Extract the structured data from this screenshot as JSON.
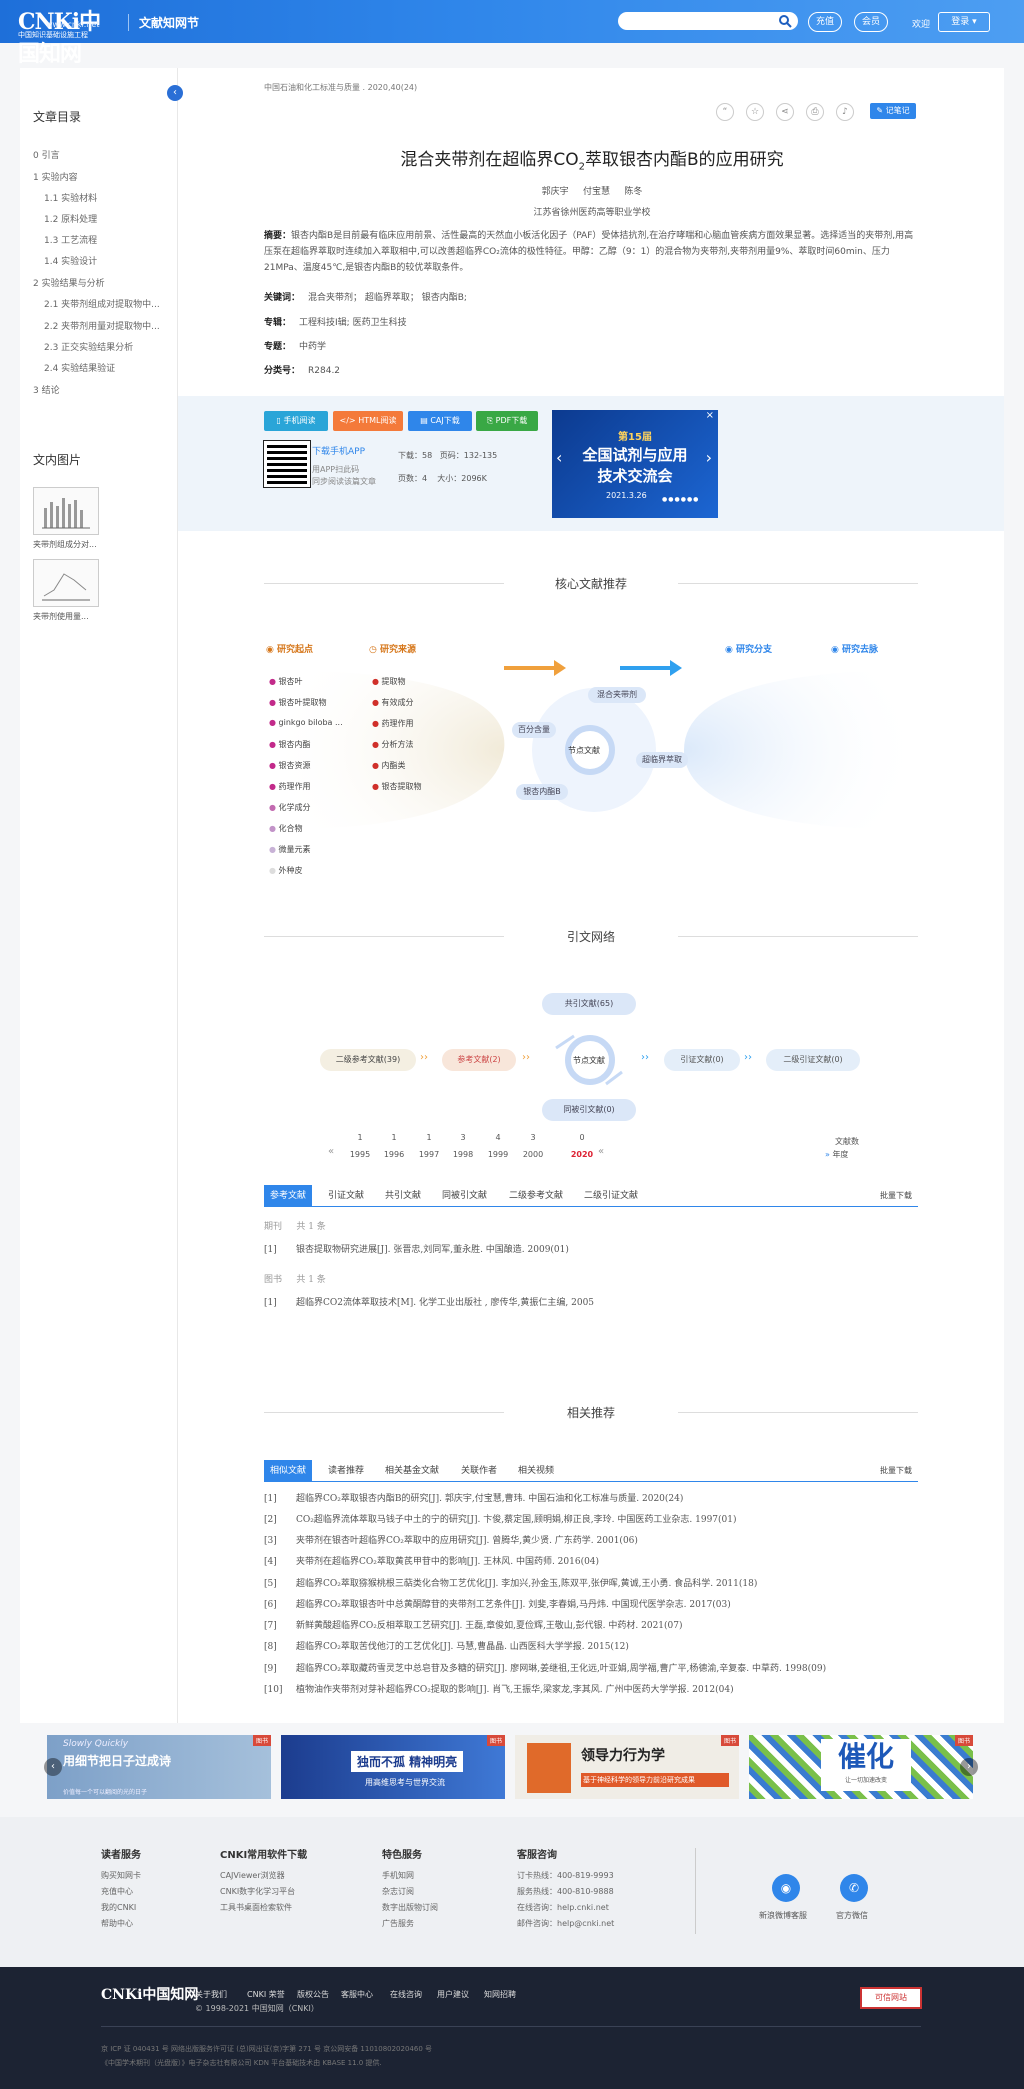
{
  "header": {
    "logo_main": "CNKi中国知网",
    "logo_url": "www.cnki.net",
    "logo_sub": "中国知识基础设施工程",
    "site_name": "文献知网节",
    "btn_recharge": "充值",
    "btn_member": "会员",
    "welcome": "欢迎",
    "login": "登录"
  },
  "sidebar": {
    "toc_title": "文章目录",
    "toc": [
      "0 引言",
      "1 实验内容",
      "1.1 实验材料",
      "1.2 原料处理",
      "1.3 工艺流程",
      "1.4 实验设计",
      "2 实验结果与分析",
      "2.1 夹带剂组成对提取物中...",
      "2.2 夹带剂用量对提取物中...",
      "2.3 正交实验结果分析",
      "2.4 实验结果验证",
      "3 结论"
    ],
    "fig_title": "文内图片",
    "figs": [
      "夹带剂组成分对...",
      "夹带剂使用量..."
    ]
  },
  "article": {
    "journal": "中国石油和化工标准与质量 . 2020,40(24)",
    "note_btn": "记笔记",
    "title_pre": "混合夹带剂在超临界CO",
    "title_sub": "2",
    "title_post": "萃取银杏内酯B的应用研究",
    "authors": [
      "郭庆宇",
      "付宝慧",
      "陈冬"
    ],
    "affiliation": "江苏省徐州医药高等职业学校",
    "abstract_label": "摘要：",
    "abstract": "银杏内酯B是目前最有临床应用前景、活性最高的天然血小板活化因子（PAF）受体拮抗剂,在治疗哮喘和心脑血管疾病方面效果显著。选择适当的夹带剂,用高压泵在超临界萃取时连续加入萃取相中,可以改善超临界CO₂流体的极性特征。甲醇：乙醇（9：1）的混合物为夹带剂,夹带剂用量9%、萃取时间60min、压力21MPa、温度45℃,是银杏内酯B的较优萃取条件。",
    "keywords_label": "关键词：",
    "keywords": "混合夹带剂；  超临界萃取；  银杏内酯B;",
    "series_label": "专辑：",
    "series": "工程科技Ⅰ辑; 医药卫生科技",
    "topic_label": "专题：",
    "topic": "中药学",
    "class_label": "分类号：",
    "class_no": "R284.2"
  },
  "downloads": {
    "btns": [
      "手机阅读",
      "HTML阅读",
      "CAJ下载",
      "PDF下载"
    ],
    "app_link": "下载手机APP",
    "app_hint1": "用APP扫此码",
    "app_hint2": "同步阅读该篇文章",
    "stats1": "下载：58   页码：132-135",
    "stats2": "页数：4    大小：2096K",
    "banner_small": "第15届",
    "banner_line1": "全国试剂与应用",
    "banner_line2": "技术交流会",
    "banner_date": "2021.3.26"
  },
  "core": {
    "heading": "核心文献推荐",
    "start": "研究起点",
    "source": "研究来源",
    "branch": "研究分支",
    "trend": "研究去脉",
    "start_items": [
      "银杏叶",
      "银杏叶提取物",
      "ginkgo biloba ...",
      "银杏内酯",
      "银杏资源",
      "药理作用",
      "化学成分",
      "化合物",
      "微量元素",
      "外种皮"
    ],
    "source_items": [
      "提取物",
      "有效成分",
      "药理作用",
      "分析方法",
      "内酯类",
      "银杏提取物"
    ],
    "node": "节点文献",
    "kw": [
      "混合夹带剂",
      "百分含量",
      "超临界萃取",
      "银杏内酯B"
    ]
  },
  "network": {
    "heading": "引文网络",
    "co_cite": "共引文献(65)",
    "co_cited": "同被引文献(0)",
    "second_ref": "二级参考文献(39)",
    "ref": "参考文献(2)",
    "node": "节点文献",
    "cite": "引证文献(0)",
    "second_cite": "二级引证文献(0)",
    "years": [
      "1995",
      "1996",
      "1997",
      "1998",
      "1999",
      "2000",
      "2020"
    ],
    "counts": [
      "1",
      "1",
      "1",
      "3",
      "4",
      "3",
      "0"
    ],
    "right1": "文献数",
    "right2": "年度"
  },
  "refs": {
    "tabs": [
      "参考文献",
      "引证文献",
      "共引文献",
      "同被引文献",
      "二级参考文献",
      "二级引证文献"
    ],
    "batch": "批量下载",
    "grp1": "期刊",
    "grp1_n": "共 1 条",
    "r1": "银杏提取物研究进展[J]. 张晋忠,刘同军,董永胜. 中国酿造. 2009(01)",
    "grp2": "图书",
    "grp2_n": "共 1 条",
    "r2": "超临界CO2流体萃取技术[M]. 化学工业出版社 , 廖传华,黄振仁主编, 2005"
  },
  "related": {
    "heading": "相关推荐",
    "tabs": [
      "相似文献",
      "读者推荐",
      "相关基金文献",
      "关联作者",
      "相关视频"
    ],
    "batch": "批量下载",
    "items": [
      "超临界CO₂萃取银杏内酯B的研究[J]. 郭庆宇,付宝慧,曹玮. 中国石油和化工标准与质量. 2020(24)",
      "CO₂超临界流体萃取马钱子中土的宁的研究[J]. 卞俊,蔡定国,顾明娟,柳正良,李玲. 中国医药工业杂志. 1997(01)",
      "夹带剂在银杏叶超临界CO₂萃取中的应用研究[J]. 曾腾华,黄少贤. 广东药学. 2001(06)",
      "夹带剂在超临界CO₂萃取黄芪甲苷中的影响[J]. 王林风. 中国药师. 2016(04)",
      "超临界CO₂萃取猕猴桃根三萜类化合物工艺优化[J]. 李加兴,孙金玉,陈双平,张伊晖,黄诚,王小勇. 食品科学. 2011(18)",
      "超临界CO₂萃取银杏叶中总黄酮醇苷的夹带剂工艺条件[J]. 刘斐,李春娟,马丹炜. 中国现代医学杂志. 2017(03)",
      "新鲜黄酸超临界CO₂反相萃取工艺研究[J]. 王磊,章俊如,夏俭辉,王敬山,彭代银. 中药材. 2021(07)",
      "超临界CO₂萃取苦伐他汀的工艺优化[J]. 马慧,曹晶晶. 山西医科大学学报. 2015(12)",
      "超临界CO₂萃取藏药雪灵芝中总皂苷及多糖的研究[J]. 廖网琳,姜继祖,王化远,叶亚娟,周学福,曹广平,杨德渝,辛复泰. 中草药. 1998(09)",
      "植物油作夹带剂对芽补超临界CO₂提取的影响[J]. 肖飞,王振华,梁家龙,李其风. 广州中医药大学学报. 2012(04)"
    ]
  },
  "ads": {
    "a1_top": "Slowly Quickly",
    "a1_main": "用细节把日子过成诗",
    "a1_sub": "价值每一个可以翻阅的光的日子",
    "a2_main": "独而不孤 精神明亮",
    "a2_sub": "用高维思考与世界交流",
    "a3_main": "领导力行为学",
    "a3_sub": "基于神经科学的领导力前沿研究成果",
    "a4_main": "催化",
    "a4_sub": "让一切加速改变",
    "tag": "图书"
  },
  "footer": {
    "col1_h": "读者服务",
    "col1": [
      "购买知网卡",
      "充值中心",
      "我的CNKI",
      "帮助中心"
    ],
    "col2_h": "CNKI常用软件下载",
    "col2": [
      "CAJViewer浏览器",
      "CNKI数字化学习平台",
      "工具书桌面检索软件"
    ],
    "col3_h": "特色服务",
    "col3": [
      "手机知网",
      "杂志订阅",
      "数字出版物订阅",
      "广告服务"
    ],
    "col4_h": "客服咨询",
    "col4": [
      "订卡热线：400-819-9993",
      "服务热线：400-810-9888",
      "在线咨询：help.cnki.net",
      "邮件咨询：help@cnki.net"
    ],
    "weibo": "新浪微博客服",
    "wechat": "官方微信",
    "nav": [
      "关于我们",
      "CNKI 荣誉",
      "版权公告",
      "客服中心",
      "在线咨询",
      "用户建议",
      "知网招聘"
    ],
    "copyright": "© 1998-2021 中国知网（CNKI）",
    "icp1": "京 ICP 证 040431 号  网络出版服务许可证 (总)网出证(京)字第 271 号  京公网安备 11010802020460 号",
    "icp2": "《中国学术期刊（光盘版）》电子杂志社有限公司 KDN 平台基础技术由 KBASE 11.0 提供.",
    "badge": "可信网站"
  }
}
